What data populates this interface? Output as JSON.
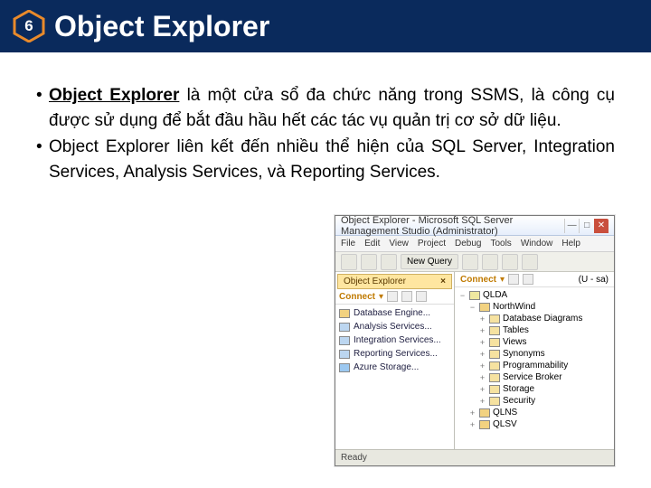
{
  "slide": {
    "number": "6",
    "title": "Object Explorer"
  },
  "bullets": {
    "b1_strong": "Object Explorer",
    "b1_rest": " là một cửa sổ đa chức năng trong SSMS, là công cụ được sử dụng để bắt đầu hầu hết các tác vụ quản trị cơ sở dữ liệu.",
    "b2": "Object Explorer liên kết đến nhiều thể hiện của SQL Server, Integration Services, Analysis Services, và Reporting Services."
  },
  "ssms": {
    "window_title": "Object Explorer - Microsoft SQL Server Management Studio (Administrator)",
    "menu": [
      "File",
      "Edit",
      "View",
      "Project",
      "Debug",
      "Tools",
      "Window",
      "Help"
    ],
    "new_query": "New Query",
    "panel_tab": "Object Explorer",
    "connect": "Connect",
    "left_items": [
      {
        "label": "Database Engine...",
        "kind": "db"
      },
      {
        "label": "Analysis Services...",
        "kind": "srv"
      },
      {
        "label": "Integration Services...",
        "kind": "srv"
      },
      {
        "label": "Reporting Services...",
        "kind": "srv"
      },
      {
        "label": "Azure Storage...",
        "kind": "az"
      }
    ],
    "right_conn_suffix": "(U - sa)",
    "tree": [
      {
        "ind": 0,
        "tw": "−",
        "kind": "srv",
        "label": "QLDA"
      },
      {
        "ind": 1,
        "tw": "−",
        "kind": "db",
        "label": "NorthWind"
      },
      {
        "ind": 2,
        "tw": "+",
        "kind": "fld",
        "label": "Database Diagrams"
      },
      {
        "ind": 2,
        "tw": "+",
        "kind": "fld",
        "label": "Tables"
      },
      {
        "ind": 2,
        "tw": "+",
        "kind": "fld",
        "label": "Views"
      },
      {
        "ind": 2,
        "tw": "+",
        "kind": "fld",
        "label": "Synonyms"
      },
      {
        "ind": 2,
        "tw": "+",
        "kind": "fld",
        "label": "Programmability"
      },
      {
        "ind": 2,
        "tw": "+",
        "kind": "fld",
        "label": "Service Broker"
      },
      {
        "ind": 2,
        "tw": "+",
        "kind": "fld",
        "label": "Storage"
      },
      {
        "ind": 2,
        "tw": "+",
        "kind": "fld",
        "label": "Security"
      },
      {
        "ind": 1,
        "tw": "+",
        "kind": "db",
        "label": "QLNS"
      },
      {
        "ind": 1,
        "tw": "+",
        "kind": "db",
        "label": "QLSV"
      }
    ],
    "status": "Ready"
  }
}
